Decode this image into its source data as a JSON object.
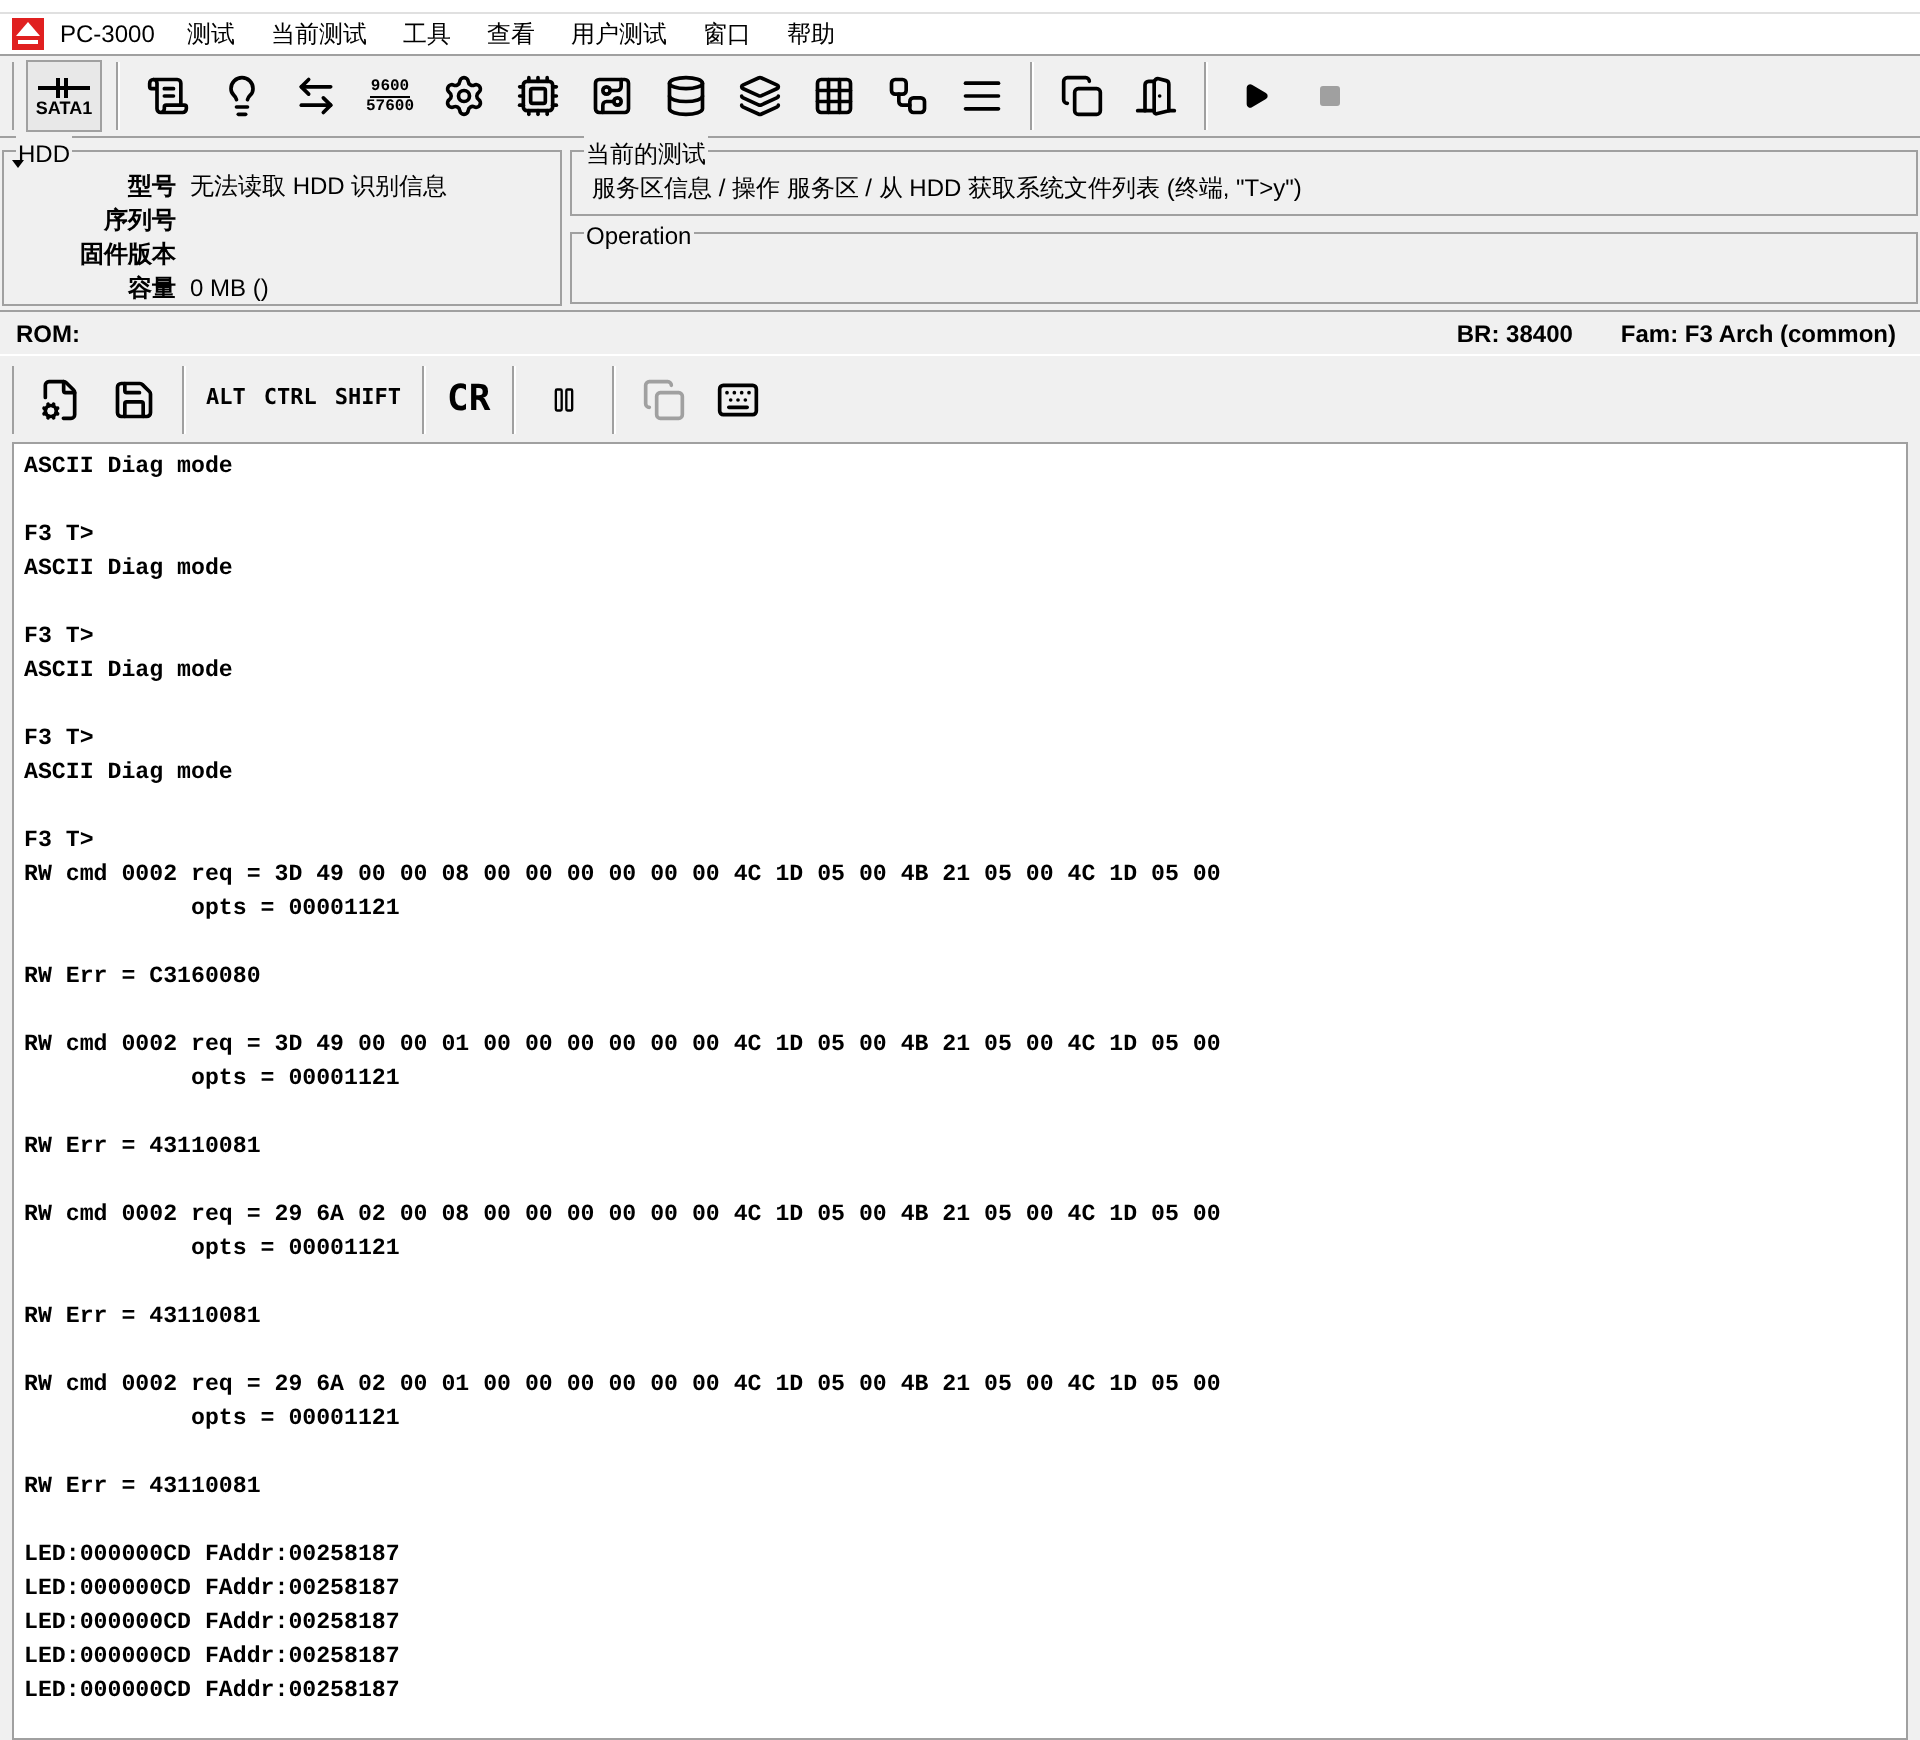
{
  "menu_bar": {
    "app": "PC-3000",
    "items": [
      "测试",
      "当前测试",
      "工具",
      "查看",
      "用户测试",
      "窗口",
      "帮助"
    ]
  },
  "toolbar": {
    "port_button": {
      "label": "SATA1",
      "selected": true
    },
    "baud_button": {
      "lines": [
        "9600",
        "57600"
      ]
    },
    "play_enabled": true,
    "stop_enabled": false
  },
  "hdd_panel": {
    "title": "HDD",
    "fields": [
      {
        "label": "型号",
        "value": "无法读取 HDD 识别信息"
      },
      {
        "label": "序列号"
      },
      {
        "label": "固件版本"
      },
      {
        "label": "容量",
        "value": "0 MB ()"
      }
    ]
  },
  "current_test": {
    "title": "当前的测试",
    "text": "服务区信息 / 操作 服务区 / 从 HDD 获取系统文件列表 (终端, \"T>y\")"
  },
  "operation": {
    "title": "Operation"
  },
  "status_bar": {
    "rom": "ROM:",
    "br": "BR: 38400",
    "fam": "Fam: F3 Arch (common)"
  },
  "terminal_toolbar": {
    "keys": [
      "ALT",
      "CTRL",
      "SHIFT"
    ],
    "cr": "CR",
    "copy_enabled": false
  },
  "terminal": {
    "blocks": [
      [
        "ASCII Diag mode"
      ],
      [
        "F3 T>",
        "ASCII Diag mode"
      ],
      [
        "F3 T>",
        "ASCII Diag mode"
      ],
      [
        "F3 T>",
        "ASCII Diag mode"
      ],
      [
        "F3 T>",
        "RW cmd 0002 req = 3D 49 00 00 08 00 00 00 00 00 00 4C 1D 05 00 4B 21 05 00 4C 1D 05 00",
        "            opts = 00001121"
      ],
      [
        "RW Err = C3160080"
      ],
      [
        "RW cmd 0002 req = 3D 49 00 00 01 00 00 00 00 00 00 4C 1D 05 00 4B 21 05 00 4C 1D 05 00",
        "            opts = 00001121"
      ],
      [
        "RW Err = 43110081"
      ],
      [
        "RW cmd 0002 req = 29 6A 02 00 08 00 00 00 00 00 00 4C 1D 05 00 4B 21 05 00 4C 1D 05 00",
        "            opts = 00001121"
      ],
      [
        "RW Err = 43110081"
      ],
      [
        "RW cmd 0002 req = 29 6A 02 00 01 00 00 00 00 00 00 4C 1D 05 00 4B 21 05 00 4C 1D 05 00",
        "            opts = 00001121"
      ],
      [
        "RW Err = 43110081"
      ],
      [
        "LED:000000CD FAddr:00258187",
        "LED:000000CD FAddr:00258187",
        "LED:000000CD FAddr:00258187",
        "LED:000000CD FAddr:00258187",
        "LED:000000CD FAddr:00258187"
      ]
    ]
  }
}
